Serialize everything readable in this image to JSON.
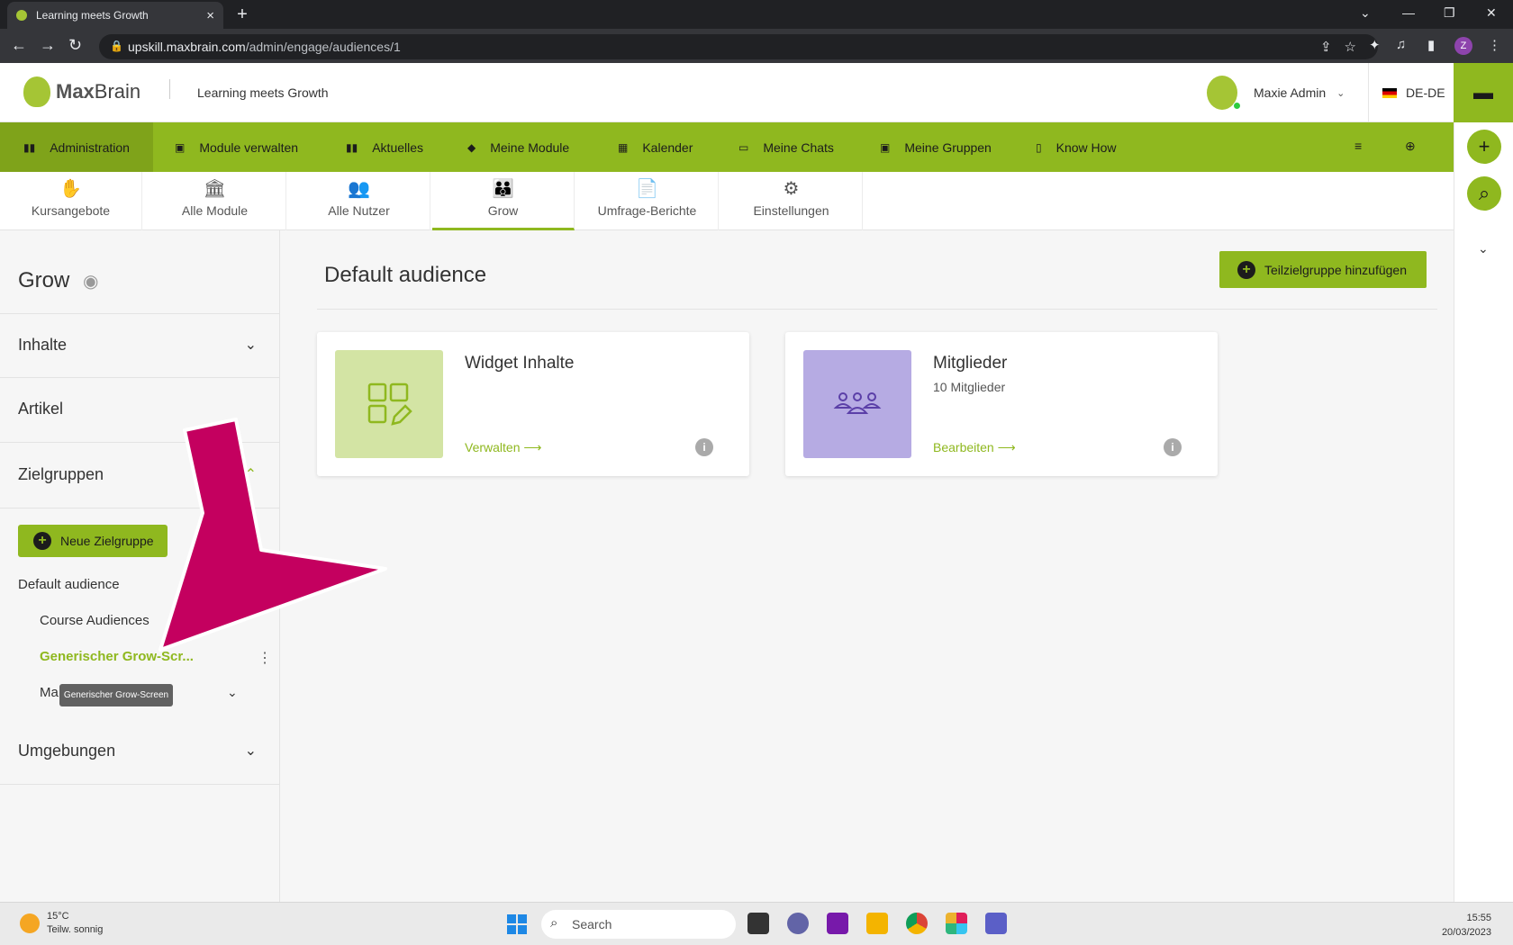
{
  "browser": {
    "tab_title": "Learning meets Growth",
    "url_host": "upskill.maxbrain.com",
    "url_path": "/admin/engage/audiences/1",
    "profile_initial": "Z"
  },
  "header": {
    "logo_bold": "Max",
    "logo_rest": "Brain",
    "tagline": "Learning meets Growth",
    "user_name": "Maxie Admin",
    "language": "DE-DE"
  },
  "main_nav": [
    {
      "label": "Administration",
      "icon": "admin-icon",
      "active": true
    },
    {
      "label": "Module verwalten",
      "icon": "folder-icon"
    },
    {
      "label": "Aktuelles",
      "icon": "news-icon"
    },
    {
      "label": "Meine Module",
      "icon": "graduation-cap-icon"
    },
    {
      "label": "Kalender",
      "icon": "calendar-icon"
    },
    {
      "label": "Meine Chats",
      "icon": "chat-icon"
    },
    {
      "label": "Meine Gruppen",
      "icon": "group-folder-icon"
    },
    {
      "label": "Know How",
      "icon": "book-icon"
    }
  ],
  "sub_nav": [
    {
      "label": "Kursangebote",
      "icon": "hand-book-icon"
    },
    {
      "label": "Alle Module",
      "icon": "institution-icon"
    },
    {
      "label": "Alle Nutzer",
      "icon": "users-icon"
    },
    {
      "label": "Grow",
      "icon": "group-icon",
      "active": true
    },
    {
      "label": "Umfrage-Berichte",
      "icon": "report-icon"
    },
    {
      "label": "Einstellungen",
      "icon": "cogs-icon"
    }
  ],
  "sidebar": {
    "title": "Grow",
    "sections": [
      "Inhalte",
      "Artikel",
      "Zielgruppen",
      "Umgebungen"
    ],
    "new_button": "Neue Zielgruppe",
    "tree": {
      "default": "Default audience",
      "course_audiences": "Course Audiences",
      "selected": "Generischer Grow-Scr...",
      "collapsed_prefix": "Ma"
    },
    "tooltip": "Generischer Grow-Screen"
  },
  "content": {
    "title": "Default audience",
    "add_button": "Teilzielgruppe hinzufügen",
    "cards": [
      {
        "title": "Widget Inhalte",
        "subtitle": "",
        "link": "Verwalten",
        "tile_color": "#d3e4a4"
      },
      {
        "title": "Mitglieder",
        "subtitle": "10 Mitglieder",
        "link": "Bearbeiten",
        "tile_color": "#b6abe3"
      }
    ]
  },
  "taskbar": {
    "temperature": "15°C",
    "weather": "Teilw. sonnig",
    "search": "Search",
    "time": "15:55",
    "date": "20/03/2023"
  },
  "colors": {
    "accent": "#8fb81f",
    "annotation_star": "#c4005f"
  }
}
